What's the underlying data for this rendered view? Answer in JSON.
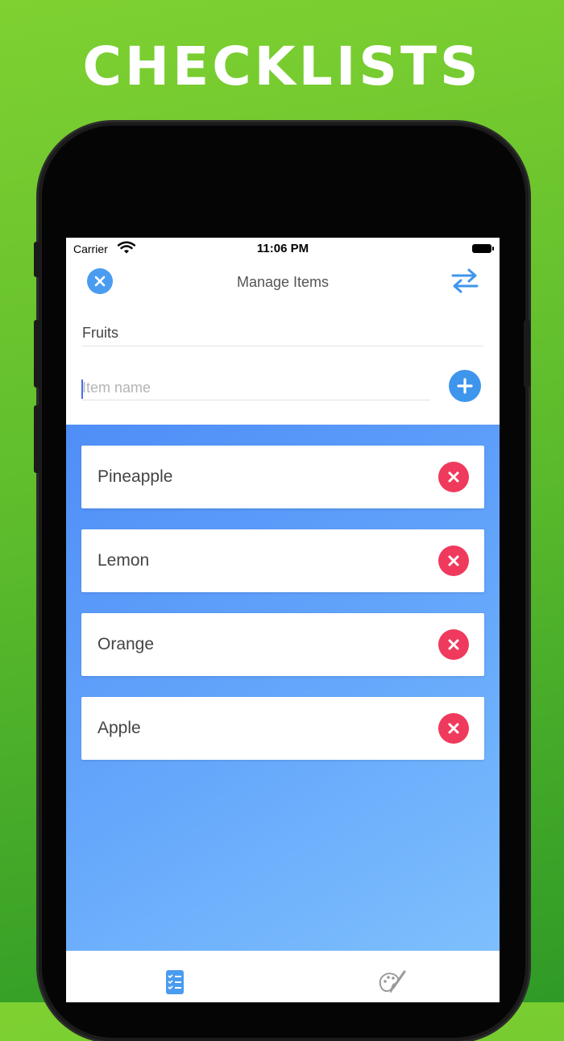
{
  "promo": {
    "title": "CHECKLISTS"
  },
  "status_bar": {
    "carrier": "Carrier",
    "time": "11:06 PM"
  },
  "nav": {
    "title": "Manage Items",
    "close_icon": "close-icon",
    "swap_icon": "swap-arrows-icon"
  },
  "list_name": "Fruits",
  "new_item": {
    "placeholder": "Item name",
    "value": ""
  },
  "items": [
    {
      "label": "Pineapple"
    },
    {
      "label": "Lemon"
    },
    {
      "label": "Orange"
    },
    {
      "label": "Apple"
    }
  ],
  "tabs": [
    {
      "icon": "checklist-icon",
      "active": true
    },
    {
      "icon": "palette-brush-icon",
      "active": false
    }
  ],
  "colors": {
    "accent_blue": "#3e95ec",
    "delete_red": "#ef3a5d",
    "promo_green": "#5cbb2c"
  }
}
